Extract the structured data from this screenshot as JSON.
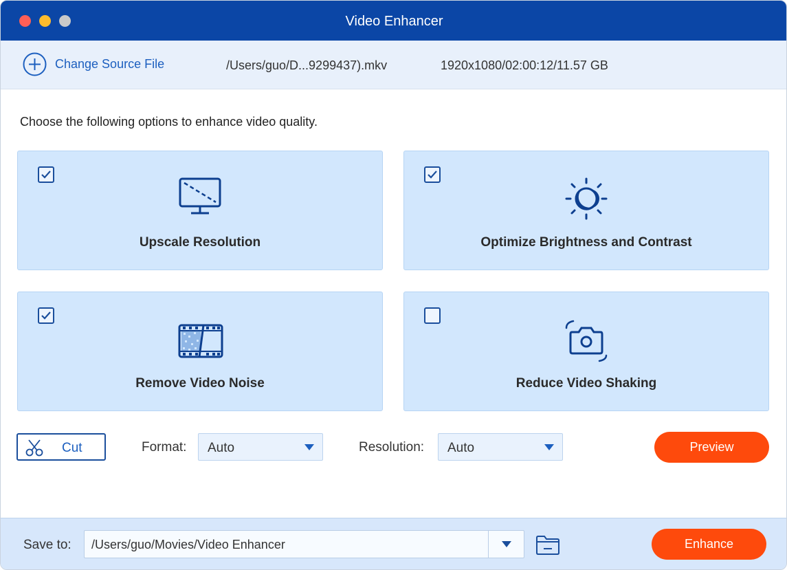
{
  "window": {
    "title": "Video Enhancer"
  },
  "source": {
    "add_label": "Change Source File",
    "filename": "/Users/guo/D...9299437).mkv",
    "info": "1920x1080/02:00:12/11.57 GB"
  },
  "instruction": "Choose the following options to enhance video quality.",
  "options": [
    {
      "label": "Upscale Resolution",
      "checked": true,
      "icon": "monitor-icon"
    },
    {
      "label": "Optimize Brightness and Contrast",
      "checked": true,
      "icon": "brightness-icon"
    },
    {
      "label": "Remove Video Noise",
      "checked": true,
      "icon": "film-noise-icon"
    },
    {
      "label": "Reduce Video Shaking",
      "checked": false,
      "icon": "camera-stabilize-icon"
    }
  ],
  "controls": {
    "cut_label": "Cut",
    "format_label": "Format:",
    "format_value": "Auto",
    "resolution_label": "Resolution:",
    "resolution_value": "Auto",
    "preview_label": "Preview"
  },
  "footer": {
    "save_label": "Save to:",
    "save_path": "/Users/guo/Movies/Video Enhancer",
    "enhance_label": "Enhance"
  },
  "colors": {
    "titlebar": "#0b46a6",
    "accent": "#1c5fbf",
    "card_bg": "#d2e7fd",
    "action_orange": "#fe4a0c"
  }
}
